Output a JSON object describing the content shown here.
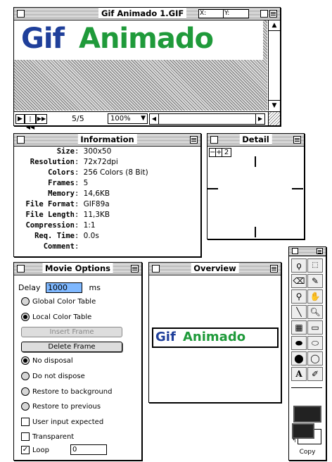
{
  "main_window": {
    "title": "Gif Animado 1.GIF",
    "x_label": "X:",
    "y_label": "Y:",
    "logo_text_1": "Gif",
    "logo_text_2": "Animado",
    "frame_counter": "5/5",
    "zoom": "100%",
    "colors": {
      "logo_blue": "#1f3f9a",
      "logo_green": "#1f9a3a"
    }
  },
  "information": {
    "title": "Information",
    "rows": [
      {
        "label": "Size",
        "value": "300x50"
      },
      {
        "label": "Resolution",
        "value": "72x72dpi"
      },
      {
        "label": "Colors",
        "value": "256 Colors (8 Bit)"
      },
      {
        "label": "Frames",
        "value": "5"
      },
      {
        "label": "Memory",
        "value": "14,6KB"
      },
      {
        "label": "File Format",
        "value": "GIF89a"
      },
      {
        "label": "File Length",
        "value": "11,3KB"
      },
      {
        "label": "Compression",
        "value": "1:1"
      },
      {
        "label": "Req. Time",
        "value": "0.0s"
      },
      {
        "label": "Comment",
        "value": ""
      }
    ]
  },
  "detail": {
    "title": "Detail",
    "minus": "−",
    "plus": "+",
    "zoom_value": "2"
  },
  "movie_options": {
    "title": "Movie Options",
    "delay_label": "Delay",
    "delay_value": "1000",
    "delay_unit": "ms",
    "global_color_table": "Global Color Table",
    "local_color_table": "Local Color Table",
    "insert_frame": "Insert Frame",
    "delete_frame": "Delete Frame",
    "no_disposal": "No disposal",
    "do_not_dispose": "Do not dispose",
    "restore_background": "Restore to background",
    "restore_previous": "Restore to previous",
    "user_input": "User input expected",
    "transparent": "Transparent",
    "loop_label": "Loop",
    "loop_value": "0"
  },
  "overview": {
    "title": "Overview",
    "logo_text_1": "Gif",
    "logo_text_2": "Animado"
  },
  "toolbox": {
    "copy_label": "Copy"
  }
}
